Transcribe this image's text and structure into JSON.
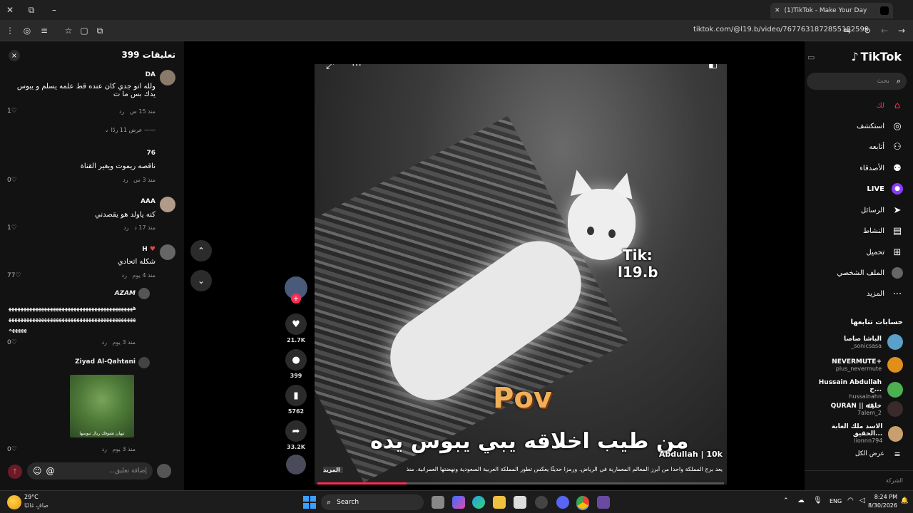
{
  "browser": {
    "tab_title": "(1)TikTok - Make Your Day",
    "url": "tiktok.com/@l19.b/video/7677631872855182599"
  },
  "comments": {
    "header": "تعليقات 399",
    "close": "×",
    "items": [
      {
        "name": "DA",
        "text": "ولله انو جدي كان عنده قط علمه يسلم و يبوس يدك بس ما ت",
        "time": "منذ 15 س",
        "reply": "رد",
        "likes": "1"
      },
      {
        "name": "",
        "text": "",
        "time": "",
        "reply": "",
        "likes": "",
        "view_replies": "عرض 11 ردًا"
      },
      {
        "name": "76",
        "text": "ناقصه ريموت ويغير القناة",
        "time": "منذ 3 س",
        "reply": "رد",
        "likes": "0"
      },
      {
        "name": "AAA",
        "text": "كنه ياولد هو يقصدني",
        "time": "منذ 17 د",
        "reply": "رد",
        "likes": "1"
      },
      {
        "name": "H",
        "text": "شكله اتحادي",
        "time": "منذ 4 يوم",
        "reply": "رد",
        "likes": "77"
      },
      {
        "name": "AZAM",
        "text": "هههههههههههههههههههههههههههههههههههههههههههههههههههههههههههههههههههههههههههههههههههههههههههه",
        "time": "منذ 3 يوم",
        "reply": "رد",
        "likes": "0"
      },
      {
        "name": "Ziyad Al-Qahtani",
        "text": "",
        "time": "منذ 3 يوم",
        "reply": "رد",
        "likes": "0",
        "image_caption": "تيهان تشوفك ريال تبوسها"
      }
    ],
    "input_placeholder": "...إضافة تعليق"
  },
  "video": {
    "overlay_tik": "Tik:",
    "overlay_handle": "l19.b",
    "pov": "Pov",
    "caption_big": "من طيب اخلاقه يبي يبوس يده",
    "author": "Abdullah | 10k",
    "description": "يعد برج المملكة واحدا من أبرز المعالم المعمارية في الرياض. ورمزا حديثًا يعكس تطور المملكة العربية السعودية ونهضتها العمرانية. منذ",
    "more": "المزيد"
  },
  "actions": {
    "likes": "21.7K",
    "comments": "399",
    "saves": "5762",
    "shares": "33.2K"
  },
  "sidebar": {
    "logo": "TikTok",
    "search_placeholder": "بحث",
    "nav": [
      {
        "label": "لك",
        "icon": "home-icon"
      },
      {
        "label": "استكشف",
        "icon": "compass-icon"
      },
      {
        "label": "أتابعه",
        "icon": "following-icon"
      },
      {
        "label": "الأصدقاء",
        "icon": "friends-icon"
      },
      {
        "label": "LIVE",
        "icon": "live-icon"
      },
      {
        "label": "الرسائل",
        "icon": "messages-icon"
      },
      {
        "label": "النشاط",
        "icon": "activity-icon"
      },
      {
        "label": "تحميل",
        "icon": "upload-icon"
      },
      {
        "label": "الملف الشخصي",
        "icon": "profile-icon"
      },
      {
        "label": "المزيد",
        "icon": "more-icon"
      }
    ],
    "following_title": "حسابات تتابعها",
    "following": [
      {
        "name": "الباشا صاصا",
        "handle": "_sonicsasa"
      },
      {
        "name": "NEVERMUTE+",
        "handle": "plus_nevermute"
      },
      {
        "name": "Hussain Abdullah ح...",
        "handle": "hussainahn"
      },
      {
        "name": "QURAN || خليـﷲ",
        "handle": "7alem_2"
      },
      {
        "name": "الاسد ملك الغابة الحقيق...",
        "handle": "lionnn794"
      }
    ],
    "see_all": "عرض الكل",
    "company": "الشركة"
  },
  "taskbar": {
    "weather_temp": "29°C",
    "weather_text": "صافٍ غالبًا",
    "search": "Search",
    "lang": "ENG",
    "time": "8:24 PM",
    "date": "8/30/2026"
  },
  "colors": {
    "accent": "#fe2c55",
    "live": "#8a3cff"
  }
}
